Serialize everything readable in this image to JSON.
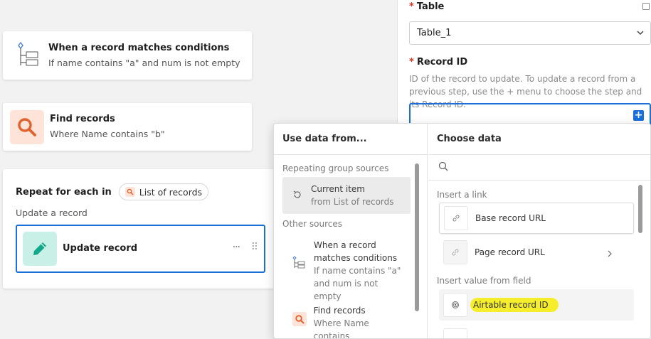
{
  "workflow": {
    "trigger": {
      "title": "When a record matches conditions",
      "subtitle": "If name contains \"a\" and num is not empty",
      "icon": "hierarchy-icon"
    },
    "find": {
      "title": "Find records",
      "subtitle": "Where Name contains \"b\"",
      "icon": "search-icon"
    },
    "repeat": {
      "label": "Repeat for each in",
      "chip": "List of records",
      "sub_label": "Update a record",
      "update_title": "Update record",
      "more": "···",
      "drag": "⠿"
    }
  },
  "panel": {
    "table_label": "Table",
    "table_value": "Table_1",
    "record_id_label": "Record ID",
    "record_id_desc": "ID of the record to update. To update a record from a previous step, use the + menu to choose the step and its Record ID.",
    "record_id_value": "",
    "plus": "+"
  },
  "popover": {
    "left_title": "Use data from...",
    "repeating_label": "Repeating group sources",
    "current_item": "Current item",
    "current_item_sub": "from List of records",
    "other_label": "Other sources",
    "other_trigger_title": "When a record matches conditions",
    "other_trigger_sub": "If name contains \"a\" and num is not empty",
    "other_find_title": "Find records",
    "other_find_sub": "Where Name contains",
    "right_title": "Choose data",
    "search_placeholder": "",
    "insert_link_label": "Insert a link",
    "base_url": "Base record URL",
    "page_url": "Page record URL",
    "insert_value_label": "Insert value from field",
    "airtable_id": "Airtable record ID"
  },
  "colors": {
    "accent": "#1a6fd8",
    "find_bg": "#fde3d8",
    "find_fg": "#e1622f",
    "update_bg": "#c9f0e6",
    "update_fg": "#13a889",
    "highlight": "#f6ee2c"
  }
}
